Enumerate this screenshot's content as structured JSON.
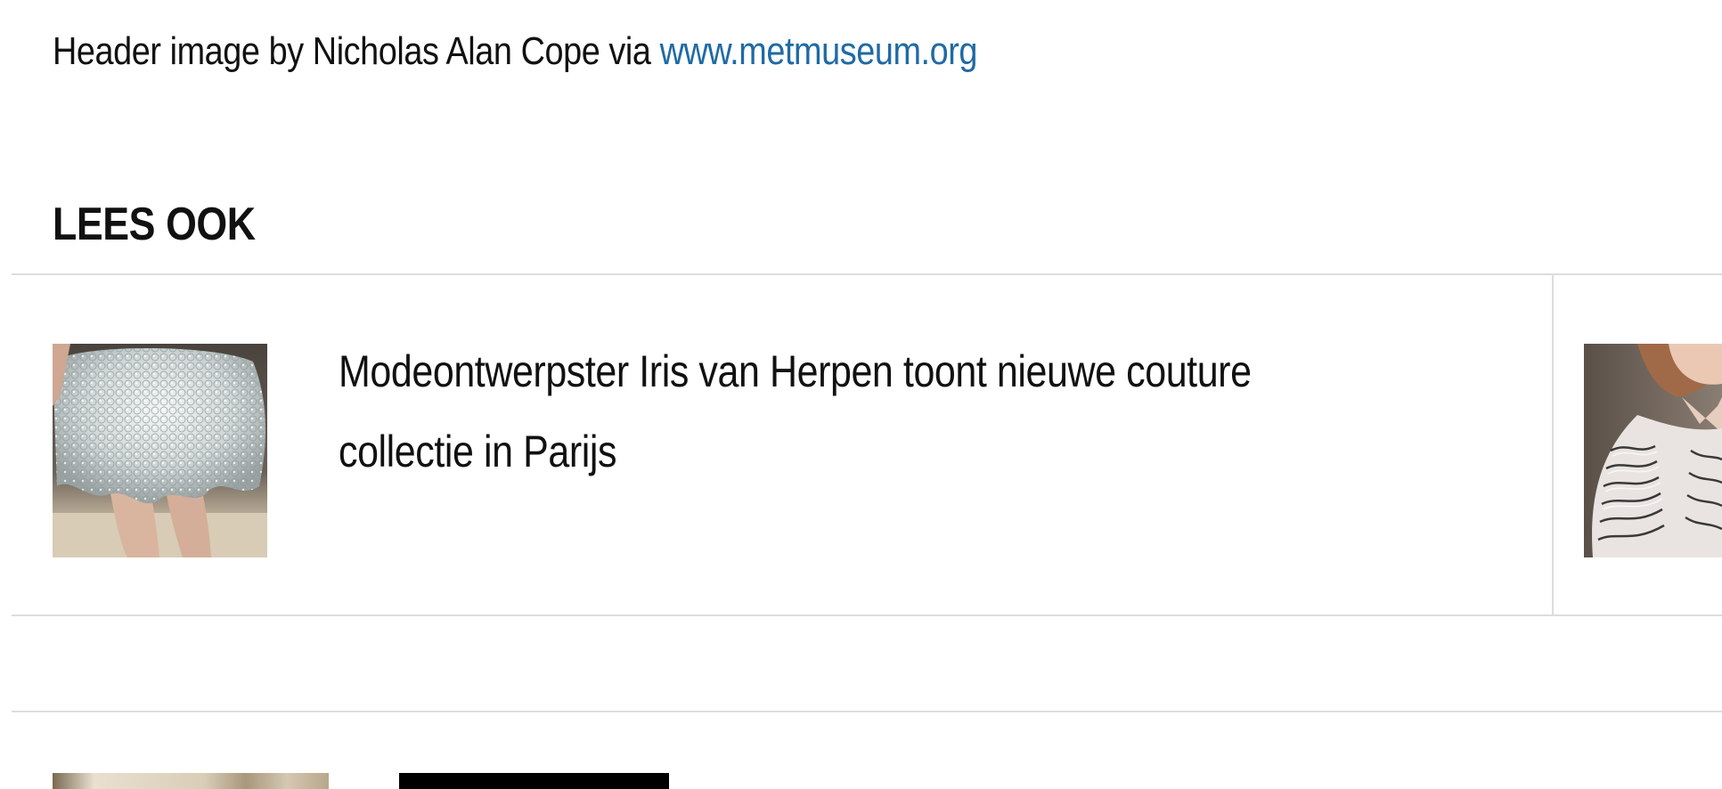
{
  "credit": {
    "prefix": "Header image by Nicholas Alan Cope via ",
    "link_text": "www.metmuseum.org"
  },
  "related": {
    "heading": "LEES OOK",
    "articles": [
      {
        "title": "Modeontwerpster Iris van Herpen toont nieuwe couture collectie in Parijs",
        "image_icon": "runway-dress-photo"
      },
      {
        "title": "",
        "image_icon": "sculptural-garment-photo"
      }
    ]
  },
  "colors": {
    "link": "#1f6aa5",
    "divider": "#dddddd",
    "text": "#111111"
  }
}
